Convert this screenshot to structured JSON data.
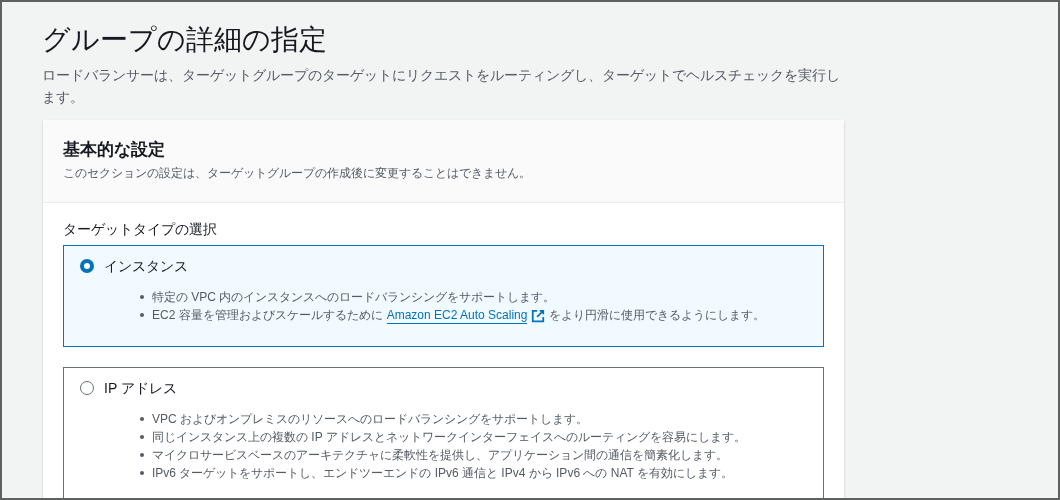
{
  "page": {
    "title": "グループの詳細の指定",
    "description": "ロードバランサーは、ターゲットグループのターゲットにリクエストをルーティングし、ターゲットでヘルスチェックを実行します。"
  },
  "panel": {
    "title": "基本的な設定",
    "subtitle": "このセクションの設定は、ターゲットグループの作成後に変更することはできません。",
    "field_label": "ターゲットタイプの選択",
    "options": [
      {
        "label": "インスタンス",
        "selected": true,
        "bullets": [
          [
            {
              "kind": "text",
              "text": "特定の VPC 内のインスタンスへのロードバランシングをサポートします。"
            }
          ],
          [
            {
              "kind": "text",
              "text": "EC2 容量を管理およびスケールするために"
            },
            {
              "kind": "link",
              "text": "Amazon EC2 Auto Scaling"
            },
            {
              "kind": "text",
              "text": "をより円滑に使用できるようにします。"
            }
          ]
        ]
      },
      {
        "label": "IP アドレス",
        "selected": false,
        "bullets": [
          [
            {
              "kind": "text",
              "text": "VPC およびオンプレミスのリソースへのロードバランシングをサポートします。"
            }
          ],
          [
            {
              "kind": "text",
              "text": "同じインスタンス上の複数の IP アドレスとネットワークインターフェイスへのルーティングを容易にします。"
            }
          ],
          [
            {
              "kind": "text",
              "text": "マイクロサービスベースのアーキテクチャに柔軟性を提供し、アプリケーション間の通信を簡素化します。"
            }
          ],
          [
            {
              "kind": "text",
              "text": "IPv6 ターゲットをサポートし、エンドツーエンドの IPv6 通信と IPv4 から IPv6 への NAT を有効にします。"
            }
          ]
        ]
      }
    ]
  }
}
